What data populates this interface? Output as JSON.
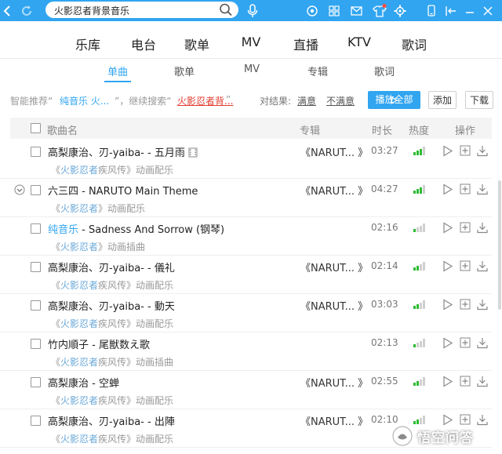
{
  "search": {
    "value": "火影忍者背景音乐"
  },
  "main_nav": [
    "乐库",
    "电台",
    "歌单",
    "MV",
    "直播",
    "KTV",
    "歌词"
  ],
  "sub_nav": {
    "tabs": [
      "单曲",
      "歌单",
      "MV",
      "专辑",
      "歌词"
    ],
    "active": "单曲"
  },
  "recommend": {
    "prefix": "智能推荐“",
    "suggestion": "纯音乐 火...",
    "middle": "”，继续搜索“",
    "query": "火影忍者背...",
    "suffix": "”",
    "feedback_label": "对结果:",
    "satisfied": "满意",
    "unsatisfied": "不满意"
  },
  "actions": {
    "play_all": "播放全部",
    "add": "添加",
    "download": "下载"
  },
  "table": {
    "headers": {
      "name": "歌曲名",
      "album": "专辑",
      "duration": "时长",
      "heat": "热度",
      "ops": "操作"
    },
    "rows": [
      {
        "title": "高梨康治、刃-yaiba- - 五月雨",
        "pre": "《",
        "hl": "火影忍者",
        "post": "疾风传》动画配乐",
        "album": "《NARUT... 》",
        "duration": "03:27",
        "heat": 3,
        "mv": true
      },
      {
        "title": "六三四 - NARUTO Main Theme",
        "pre": "《",
        "hl": "火影忍者",
        "post": "》动画配乐",
        "album": "《NARUT... 》",
        "duration": "04:27",
        "heat": 3,
        "expanded": true
      },
      {
        "title_prefix": "纯音乐",
        "title": " - Sadness And Sorrow (钢琴)",
        "pre": "《",
        "hl": "火影忍者",
        "post": "》动画插曲",
        "album": "",
        "duration": "02:16",
        "heat": 1
      },
      {
        "title": "高梨康治、刃-yaiba- - 儀礼",
        "pre": "《",
        "hl": "火影忍者",
        "post": "疾风传》动画配乐",
        "album": "《NARUT... 》",
        "duration": "02:14",
        "heat": 2
      },
      {
        "title": "高梨康治、刃-yaiba- - 動天",
        "pre": "《",
        "hl": "火影忍者",
        "post": "疾风传》动画配乐",
        "album": "《NARUT... 》",
        "duration": "03:03",
        "heat": 2
      },
      {
        "title": "竹内順子 - 尾獣数え歌",
        "pre": "《",
        "hl": "火影忍者",
        "post": "疾风传》动画插曲",
        "album": "",
        "duration": "02:13",
        "heat": 1
      },
      {
        "title": "高梨康治 - 空蝉",
        "pre": "《",
        "hl": "火影忍者",
        "post": "疾风传》动画配乐",
        "album": "《NARUT... 》",
        "duration": "02:55",
        "heat": 2
      },
      {
        "title": "高梨康治、刃-yaiba- - 出陣",
        "pre": "《",
        "hl": "火影忍者",
        "post": "疾风传》动画配乐",
        "album": "《NARUT... 》",
        "duration": "02:10",
        "heat": 2
      }
    ]
  },
  "watermark": {
    "text": "悟空问答"
  },
  "colors": {
    "accent": "#31a5f0",
    "heat_on": "#2dbb32",
    "heat_off": "#d0d0d0",
    "highlight_red": "#e23c2e"
  }
}
